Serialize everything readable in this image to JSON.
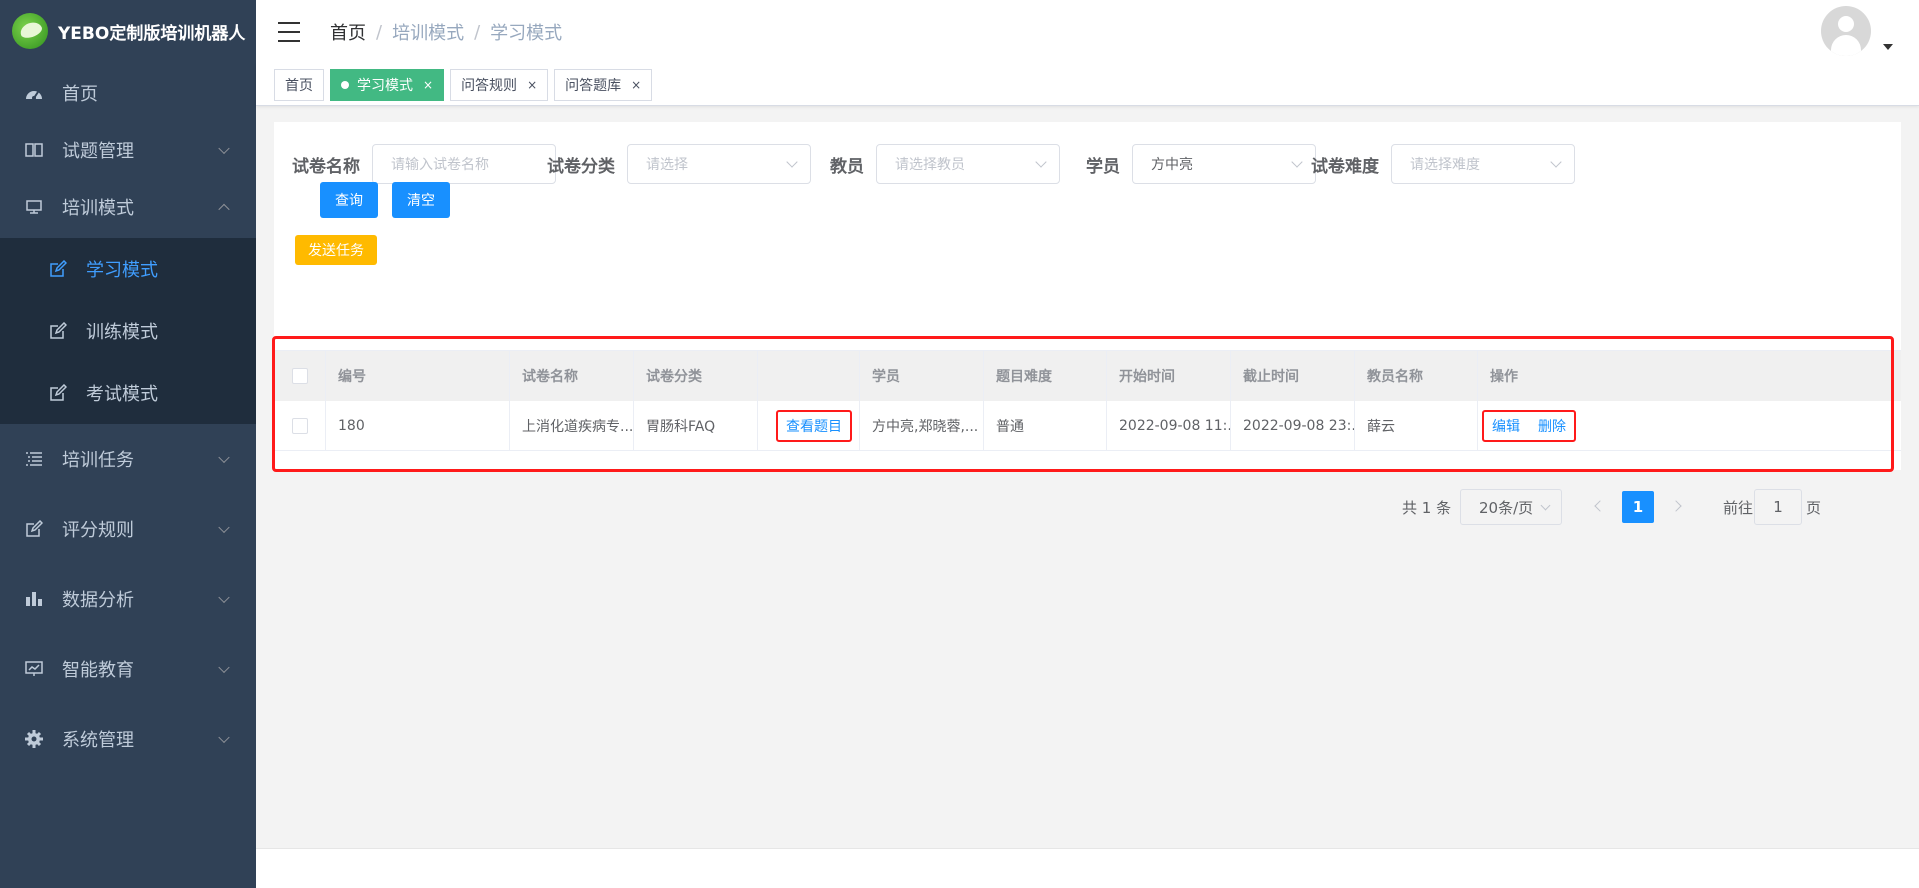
{
  "app": {
    "title": "YEBO定制版培训机器人"
  },
  "sidebar": {
    "items": [
      {
        "label": "首页",
        "icon": "dashboard-icon"
      },
      {
        "label": "试题管理",
        "icon": "book-icon"
      },
      {
        "label": "培训模式",
        "icon": "monitor-icon",
        "expanded": true
      },
      {
        "label": "培训任务",
        "icon": "list-icon"
      },
      {
        "label": "评分规则",
        "icon": "edit-icon"
      },
      {
        "label": "数据分析",
        "icon": "bar-chart-icon"
      },
      {
        "label": "智能教育",
        "icon": "screen-icon"
      },
      {
        "label": "系统管理",
        "icon": "gear-icon"
      }
    ],
    "sub_items": [
      {
        "label": "学习模式",
        "active": true
      },
      {
        "label": "训练模式"
      },
      {
        "label": "考试模式"
      }
    ]
  },
  "breadcrumb": [
    "首页",
    "培训模式",
    "学习模式"
  ],
  "tags": [
    {
      "label": "首页"
    },
    {
      "label": "学习模式",
      "active": true,
      "close": "×"
    },
    {
      "label": "问答规则",
      "close": "×"
    },
    {
      "label": "问答题库",
      "close": "×"
    }
  ],
  "filters": {
    "paper_name": {
      "label": "试卷名称",
      "placeholder": "请输入试卷名称"
    },
    "paper_category": {
      "label": "试卷分类",
      "placeholder": "请选择"
    },
    "teacher": {
      "label": "教员",
      "placeholder": "请选择教员"
    },
    "student": {
      "label": "学员",
      "value": "方中亮"
    },
    "difficulty": {
      "label": "试卷难度",
      "placeholder": "请选择难度"
    }
  },
  "buttons": {
    "query": "查询",
    "clear": "清空",
    "send_task": "发送任务"
  },
  "table": {
    "columns": [
      "编号",
      "试卷名称",
      "试卷分类",
      "",
      "学员",
      "题目难度",
      "开始时间",
      "截止时间",
      "教员名称",
      "操作"
    ],
    "rows": [
      {
        "id": "180",
        "name": "上消化道疾病专...",
        "category": "胃肠科FAQ",
        "view": "查看题目",
        "students": "方中亮,郑晓蓉,...",
        "difficulty": "普通",
        "start": "2022-09-08 11:...",
        "end": "2022-09-08 23:...",
        "teacher": "薛云",
        "edit": "编辑",
        "delete": "删除"
      }
    ]
  },
  "pagination": {
    "total": "共 1 条",
    "page_size": "20条/页",
    "current": "1",
    "goto_label": "前往",
    "goto_value": "1",
    "page_label": "页"
  },
  "colors": {
    "sidebar_bg": "#304156",
    "active": "#409eff",
    "primary": "#1890ff",
    "warning": "#ffba00",
    "tag_active": "#42b983",
    "highlight": "#ff1a1a"
  }
}
